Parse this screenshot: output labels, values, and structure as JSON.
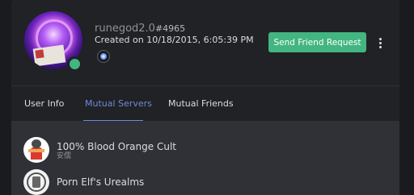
{
  "profile": {
    "username": "runegod2.0",
    "discriminator": "#4965",
    "created": "Created on 10/18/2015, 6:05:39 PM",
    "status": "online",
    "status_color": "#43b581",
    "avatar_icon": "avatar-image",
    "badge_icon": "nitro-badge-icon"
  },
  "actions": {
    "send_friend_request": "Send Friend Request",
    "more_icon": "more-vertical-icon",
    "accent_color": "#43b581"
  },
  "tabs": [
    {
      "label": "User Info",
      "active": false
    },
    {
      "label": "Mutual Servers",
      "active": true
    },
    {
      "label": "Mutual Friends",
      "active": false
    }
  ],
  "tab_accent_color": "#7289da",
  "mutual_servers": [
    {
      "name": "100% Blood Orange Cult",
      "nickname": "安儒",
      "icon": "server-icon-blood-orange"
    },
    {
      "name": "Porn Elf's Urealms",
      "nickname": "",
      "icon": "server-icon-urealms"
    }
  ]
}
